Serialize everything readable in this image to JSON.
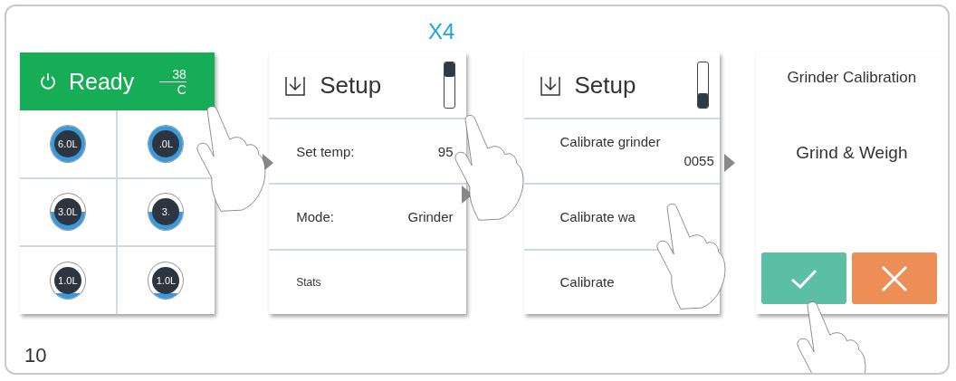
{
  "repeat_label": "X4",
  "screens": [
    {
      "kind": "home",
      "status": "Ready",
      "time": "38",
      "temperature": "C",
      "tanks": [
        {
          "label": "6.0L",
          "level": 1
        },
        {
          "label": ".0L",
          "level": 1
        },
        {
          "label": "3.0L",
          "level": 0.5
        },
        {
          "label": "3.",
          "level": 0.5
        },
        {
          "label": "1.0L",
          "level": 0.15
        },
        {
          "label": "1.0L",
          "level": 0.15
        }
      ]
    },
    {
      "kind": "menu",
      "title": "Setup",
      "scrolled_to_end": false,
      "rows": [
        {
          "label": "Set temp:",
          "value": "95",
          "kind": "setting"
        },
        {
          "label": "Mode:",
          "value": "Grinder",
          "kind": "setting"
        },
        {
          "label": "Stats",
          "kind": "link"
        }
      ]
    },
    {
      "kind": "menu",
      "title": "Setup",
      "scrolled_to_end": true,
      "rows": [
        {
          "label": "Calibrate grinder",
          "value": "0055",
          "kind": "reading"
        },
        {
          "label": "Calibrate wa",
          "kind": "setting"
        },
        {
          "label": "Calibrate",
          "kind": "setting"
        }
      ]
    },
    {
      "kind": "dialog",
      "title": "Grinder Calibration",
      "message": "Grind & Weigh",
      "buttons": [
        {
          "kind": "confirm"
        },
        {
          "kind": "cancel"
        }
      ]
    }
  ],
  "page_number": "10"
}
